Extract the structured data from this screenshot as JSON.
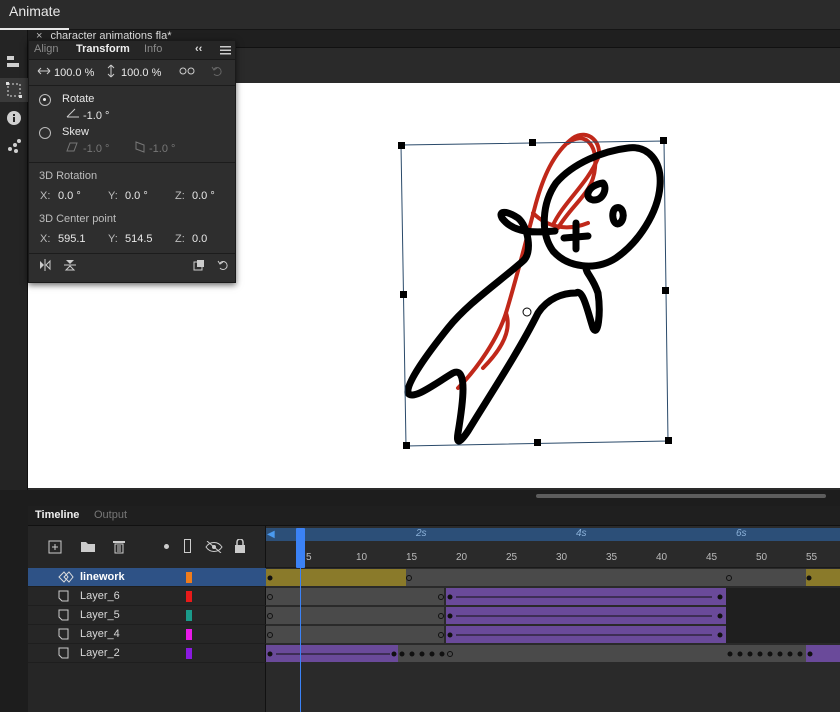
{
  "app": {
    "title": "Animate"
  },
  "document": {
    "tab_label": "character animations fla*"
  },
  "panel": {
    "tabs": [
      "Align",
      "Transform",
      "Info"
    ],
    "width_scale": "100.0 %",
    "height_scale": "100.0 %",
    "rotate_label": "Rotate",
    "rotate_value": "-1.0 °",
    "skew_label": "Skew",
    "skew_h": "-1.0 °",
    "skew_v": "-1.0 °",
    "rotation3d_label": "3D Rotation",
    "rotation3d": {
      "x_label": "X:",
      "x": "0.0 °",
      "y_label": "Y:",
      "y": "0.0 °",
      "z_label": "Z:",
      "z": "0.0 °"
    },
    "center_label": "3D Center point",
    "center": {
      "x_label": "X:",
      "x": "595.1",
      "y_label": "Y:",
      "y": "514.5",
      "z_label": "Z:",
      "z": "0.0"
    }
  },
  "timeline": {
    "tabs": [
      "Timeline",
      "Output"
    ],
    "seconds": [
      "2s",
      "4s",
      "6s"
    ],
    "frame_numbers": [
      "5",
      "10",
      "15",
      "20",
      "25",
      "30",
      "35",
      "40",
      "45",
      "50",
      "55"
    ],
    "layers": [
      {
        "name": "linework",
        "color": "#f07c1a",
        "selected": true
      },
      {
        "name": "Layer_6",
        "color": "#e81a1a",
        "selected": false
      },
      {
        "name": "Layer_5",
        "color": "#1a9a8a",
        "selected": false
      },
      {
        "name": "Layer_4",
        "color": "#e81ae8",
        "selected": false
      },
      {
        "name": "Layer_2",
        "color": "#8a1ae0",
        "selected": false
      }
    ]
  },
  "colors": {
    "accent": "#2e5286",
    "tween_purple": "#6a4a9a",
    "keyframe_gold": "#8a7a2a",
    "playhead": "#3b82f6"
  }
}
